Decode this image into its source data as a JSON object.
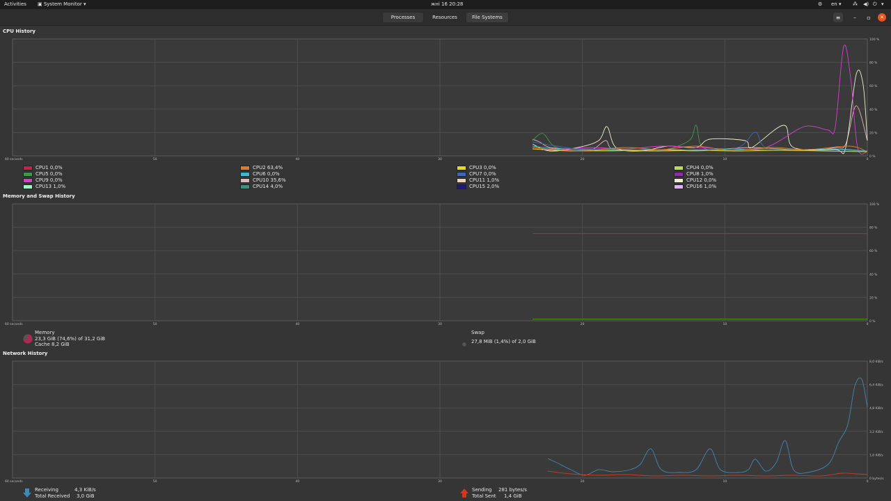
{
  "topbar": {
    "activities": "Activities",
    "app_menu": "System Monitor",
    "clock": "жні 16  20:28",
    "lang": "en"
  },
  "tabs": {
    "processes": "Processes",
    "resources": "Resources",
    "file_systems": "File Systems"
  },
  "cpu": {
    "title": "CPU History",
    "x_ticks": [
      "60 seconds",
      "50",
      "40",
      "30",
      "20",
      "10",
      "0"
    ],
    "y_ticks": [
      "100 %",
      "80 %",
      "60 %",
      "40 %",
      "20 %",
      "0 %"
    ],
    "legend": [
      {
        "label": "CPU1  0,0%",
        "color": "#c4214d"
      },
      {
        "label": "CPU2  63,4%",
        "color": "#e07b2a"
      },
      {
        "label": "CPU3  0,0%",
        "color": "#e8d62a"
      },
      {
        "label": "CPU4  0,0%",
        "color": "#b8e04a"
      },
      {
        "label": "CPU5  0,0%",
        "color": "#3e9a4a"
      },
      {
        "label": "CPU6  0,0%",
        "color": "#3fb9d0"
      },
      {
        "label": "CPU7  0,0%",
        "color": "#3d68b8"
      },
      {
        "label": "CPU8  1,0%",
        "color": "#8a2f9c"
      },
      {
        "label": "CPU9  0,0%",
        "color": "#d63fcf"
      },
      {
        "label": "CPU10  35,6%",
        "color": "#e6b3b8"
      },
      {
        "label": "CPU11  1,0%",
        "color": "#f0d2b0"
      },
      {
        "label": "CPU12  0,0%",
        "color": "#f0efcc"
      },
      {
        "label": "CPU13  1,0%",
        "color": "#a9edc4"
      },
      {
        "label": "CPU14  4,0%",
        "color": "#3f8f80"
      },
      {
        "label": "CPU15  2,0%",
        "color": "#1e1a7a"
      },
      {
        "label": "CPU16  1,0%",
        "color": "#dcb4ef"
      }
    ]
  },
  "memory": {
    "title": "Memory and Swap History",
    "x_ticks": [
      "60 seconds",
      "50",
      "40",
      "30",
      "20",
      "10",
      "0"
    ],
    "y_ticks": [
      "100 %",
      "80 %",
      "60 %",
      "40 %",
      "20 %",
      "0 %"
    ],
    "mem_label": "Memory",
    "mem_used": "23,3 GiB (74,6%) of 31,2 GiB",
    "mem_cache": "Cache 8,2 GiB",
    "swap_label": "Swap",
    "swap_used": "27,8 MiB (1,4%) of 2,0 GiB",
    "mem_color": "#ad2a55",
    "swap_color": "#4e9a06",
    "mem_percent": 74.6,
    "swap_percent": 1.4
  },
  "network": {
    "title": "Network History",
    "x_ticks": [
      "60 seconds",
      "50",
      "40",
      "30",
      "20",
      "10",
      "0"
    ],
    "y_ticks": [
      "8,0 KiB/s",
      "6,4 KiB/s",
      "4,8 KiB/s",
      "3,2 KiB/s",
      "1,6 KiB/s",
      "0 bytes/s"
    ],
    "receiving_label": "Receiving",
    "receiving_value": "4,3 KiB/s",
    "total_received_label": "Total Received",
    "total_received_value": "3,0 GiB",
    "sending_label": "Sending",
    "sending_value": "281 bytes/s",
    "total_sent_label": "Total Sent",
    "total_sent_value": "1,4 GiB",
    "recv_color": "#3f87b5",
    "send_color": "#cc3a1f"
  }
}
